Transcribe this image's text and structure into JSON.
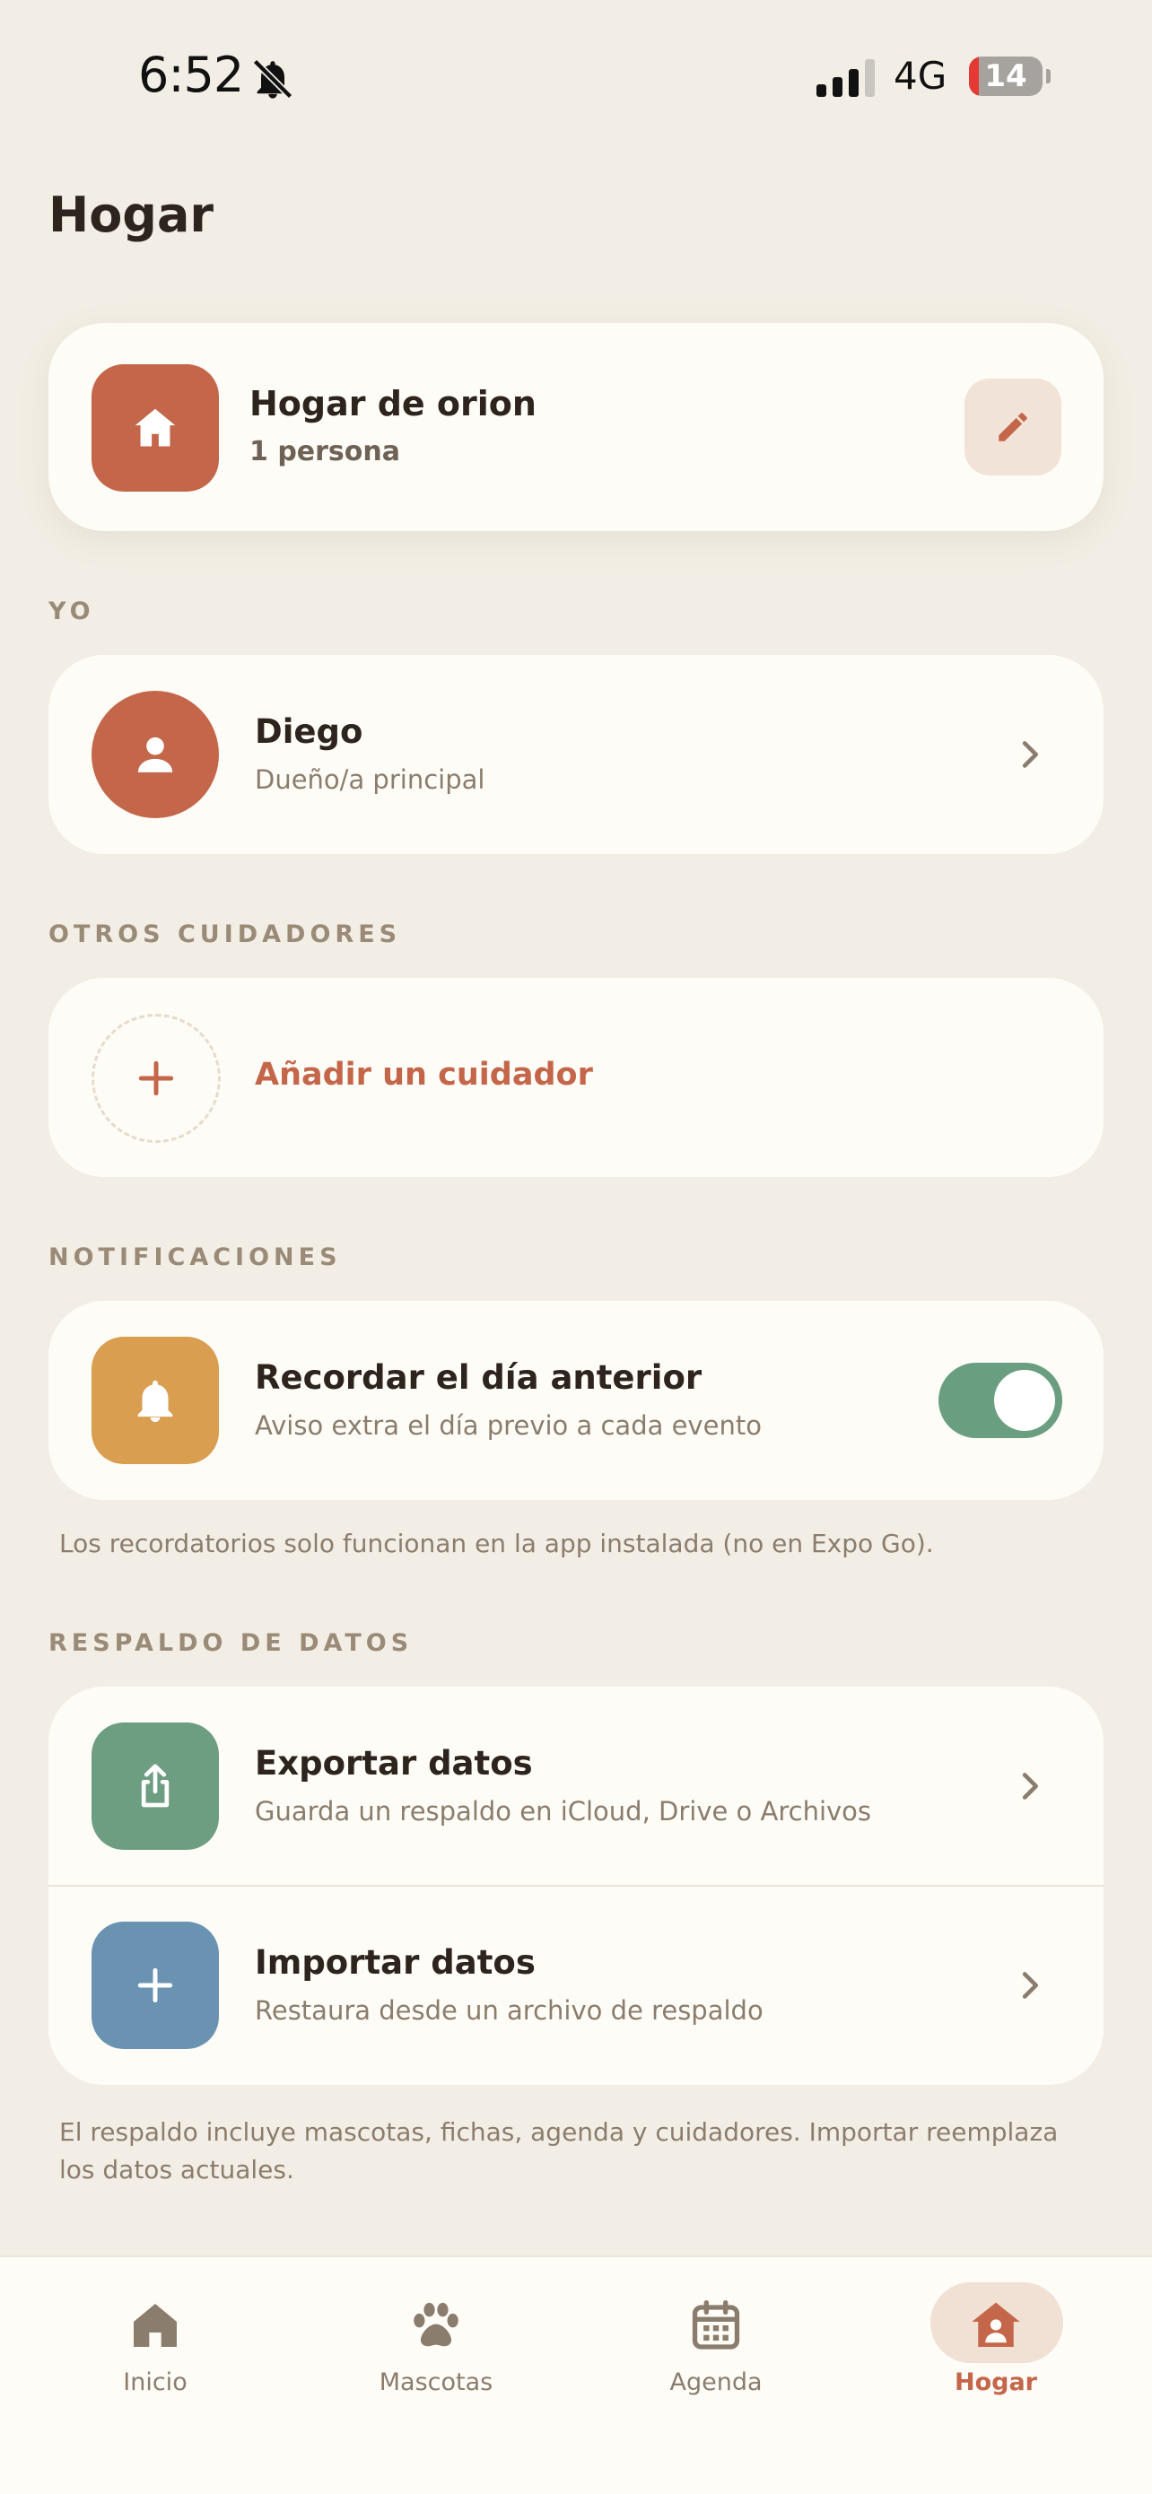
{
  "status_bar": {
    "time": "6:52",
    "network": "4G",
    "battery": "14",
    "battery_level": 0.14,
    "icons": [
      "bell-slash-icon",
      "signal-icon",
      "battery-icon"
    ]
  },
  "page": {
    "title": "Hogar"
  },
  "household": {
    "name": "Hogar de orion",
    "members": "1 persona",
    "icon": "house-icon",
    "edit_icon": "pencil-icon"
  },
  "me": {
    "section_label": "YO",
    "name": "Diego",
    "role": "Dueño/a principal",
    "icon": "person-icon"
  },
  "caregivers": {
    "section_label": "OTROS CUIDADORES",
    "add_label": "Añadir un cuidador",
    "icon": "plus-icon"
  },
  "notifications": {
    "section_label": "NOTIFICACIONES",
    "title": "Recordar el día anterior",
    "subtitle": "Aviso extra el día previo a cada evento",
    "enabled": true,
    "icon": "bell-icon",
    "note": "Los recordatorios solo funcionan en la app instalada (no en Expo Go)."
  },
  "backup": {
    "section_label": "RESPALDO DE DATOS",
    "items": [
      {
        "title": "Exportar datos",
        "subtitle": "Guarda un respaldo en iCloud, Drive o Archivos",
        "icon": "share-icon"
      },
      {
        "title": "Importar datos",
        "subtitle": "Restaura desde un archivo de respaldo",
        "icon": "plus-icon"
      }
    ],
    "note": "El respaldo incluye mascotas, fichas, agenda y cuidadores. Importar reemplaza los datos actuales."
  },
  "tabbar": {
    "items": [
      {
        "label": "Inicio",
        "icon": "home-icon",
        "active": false
      },
      {
        "label": "Mascotas",
        "icon": "paw-icon",
        "active": false
      },
      {
        "label": "Agenda",
        "icon": "calendar-icon",
        "active": false
      },
      {
        "label": "Hogar",
        "icon": "household-icon",
        "active": true
      }
    ]
  },
  "colors": {
    "background": "#F3EEE5",
    "card": "#FEFCF6",
    "accent": "#C4664A",
    "notification_tile": "#D99E4F",
    "export_tile": "#6E9E82",
    "import_tile": "#6A93B2",
    "toggle_on": "#6A9E80"
  }
}
